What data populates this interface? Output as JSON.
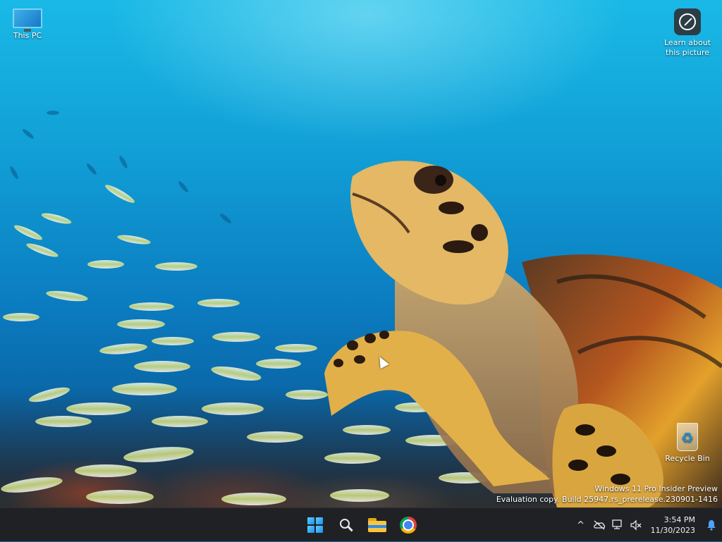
{
  "desktop": {
    "icons": [
      {
        "id": "this-pc",
        "label": "This PC"
      },
      {
        "id": "learn",
        "label_line1": "Learn about",
        "label_line2": "this picture"
      },
      {
        "id": "recycle-bin",
        "label": "Recycle Bin"
      }
    ],
    "watermark": {
      "line1": "Windows 11 Pro Insider Preview",
      "line2": "Evaluation copy. Build 25947.rs_prerelease.230901-1416"
    }
  },
  "taskbar": {
    "pinned": [
      {
        "name": "start-button",
        "icon": "windows-logo-icon"
      },
      {
        "name": "search-button",
        "icon": "search-icon"
      },
      {
        "name": "file-explorer-button",
        "icon": "folder-icon"
      },
      {
        "name": "chrome-button",
        "icon": "chrome-icon"
      }
    ],
    "tray": {
      "chevron": "^",
      "time": "3:54 PM",
      "date": "11/30/2023"
    }
  },
  "colors": {
    "taskbar_bg": "#202124",
    "accent": "#4da3ff"
  }
}
